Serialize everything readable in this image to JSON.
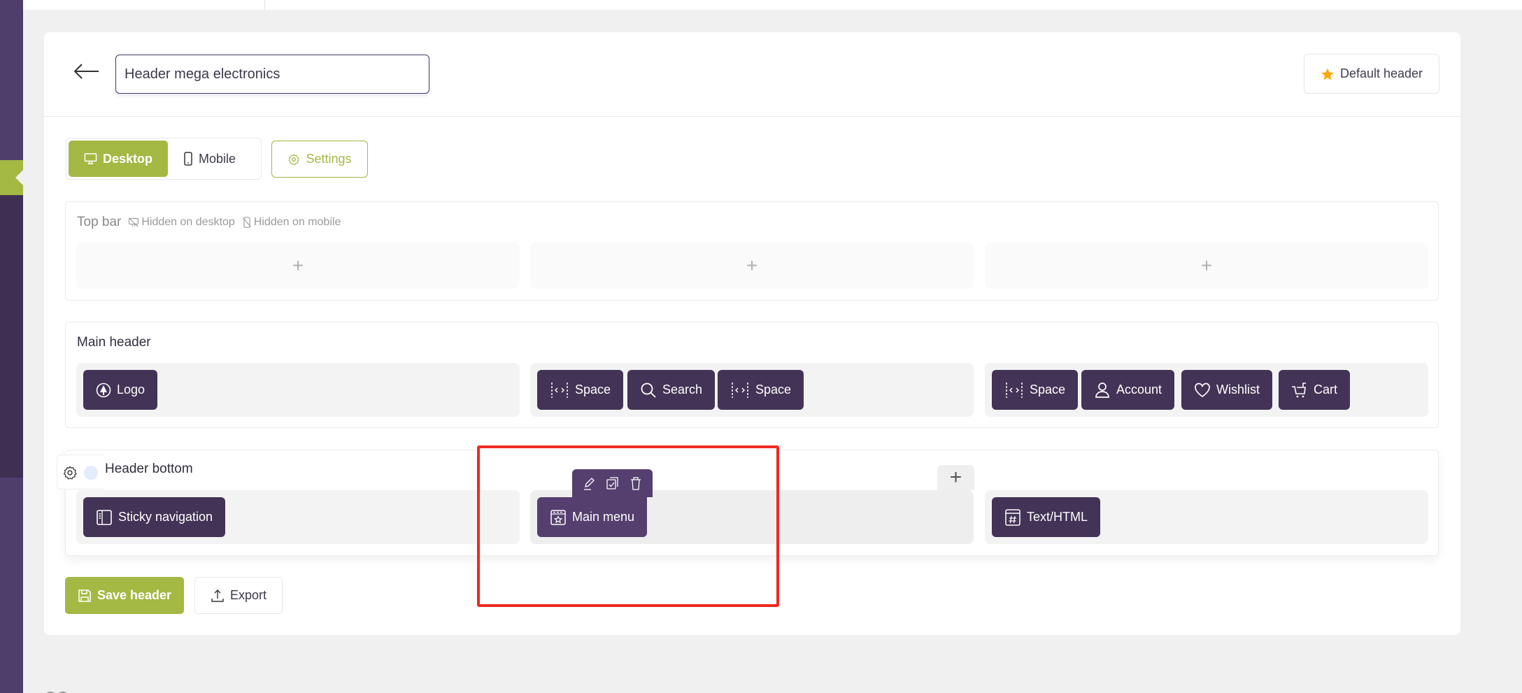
{
  "editor": {
    "header_name_value": "Header mega electronics",
    "back_label": "Back",
    "default_button_label": "Default header",
    "default_icon": "star-icon",
    "accent_color": "#a4b844",
    "element_color": "#433356",
    "star_color": "#ffa500"
  },
  "view_tabs": [
    {
      "label": "Desktop",
      "icon": "desktop-icon",
      "active": true
    },
    {
      "label": "Mobile",
      "icon": "mobile-icon",
      "active": false
    }
  ],
  "settings_label": "Settings",
  "rows": {
    "top_bar": {
      "label": "Top bar",
      "hidden_desktop": "Hidden on desktop",
      "hidden_mobile": "Hidden on mobile",
      "columns": [
        [],
        [],
        []
      ]
    },
    "main_header": {
      "label": "Main header",
      "columns": [
        [
          {
            "label": "Logo",
            "icon": "logo-icon"
          }
        ],
        [
          {
            "label": "Space",
            "icon": "space-icon"
          },
          {
            "label": "Search",
            "icon": "search-icon"
          },
          {
            "label": "Space",
            "icon": "space-icon"
          }
        ],
        [
          {
            "label": "Space",
            "icon": "space-icon"
          },
          {
            "label": "Account",
            "icon": "account-icon"
          },
          {
            "label": "Wishlist",
            "icon": "heart-icon"
          },
          {
            "label": "Cart",
            "icon": "cart-icon"
          }
        ]
      ]
    },
    "header_bottom": {
      "label": "Header bottom",
      "columns": [
        [
          {
            "label": "Sticky navigation",
            "icon": "sticky-nav-icon"
          }
        ],
        [
          {
            "label": "Main menu",
            "icon": "menu-icon",
            "selected": true
          }
        ],
        [
          {
            "label": "Text/HTML",
            "icon": "html-icon"
          }
        ]
      ],
      "element_tools": [
        "edit-icon",
        "duplicate-icon",
        "delete-icon"
      ]
    }
  },
  "footer": {
    "save_label": "Save header",
    "export_label": "Export"
  }
}
